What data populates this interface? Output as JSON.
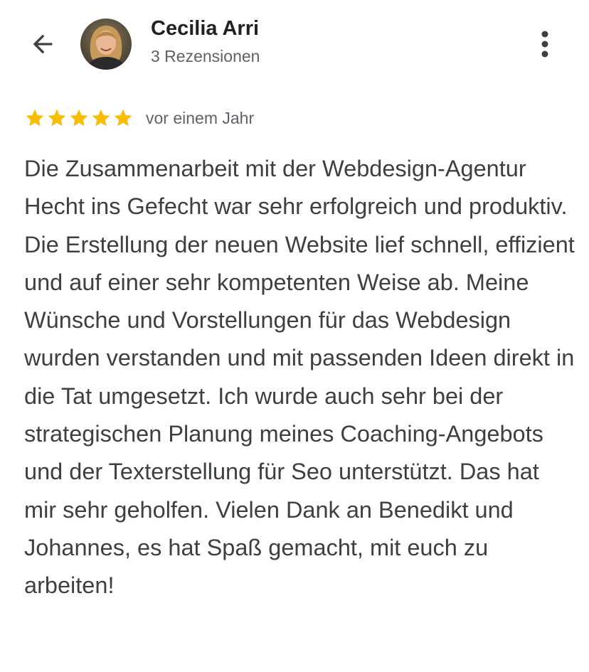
{
  "header": {
    "back_icon": "arrow-left-icon",
    "reviewer_name": "Cecilia Arri",
    "review_count": "3 Rezensionen",
    "more_icon": "more-vertical-icon"
  },
  "review": {
    "rating": 5,
    "max_rating": 5,
    "star_color": "#fbbc04",
    "date": "vor einem Jahr",
    "text": "Die Zusammenarbeit mit der Webdesign-Agentur Hecht ins Gefecht war sehr erfolgreich und produktiv. Die Erstellung der neuen Website lief schnell, effizient und auf einer sehr kompetenten Weise ab. Meine Wünsche und Vorstellungen für das Webdesign wurden verstanden und mit passenden Ideen direkt in die Tat umgesetzt. Ich wurde auch sehr bei der strategischen Planung meines Coaching-Angebots und der Texterstellung für Seo unterstützt. Das hat mir sehr geholfen. Vielen Dank an Benedikt und Johannes, es hat Spaß gemacht, mit euch zu arbeiten!"
  }
}
